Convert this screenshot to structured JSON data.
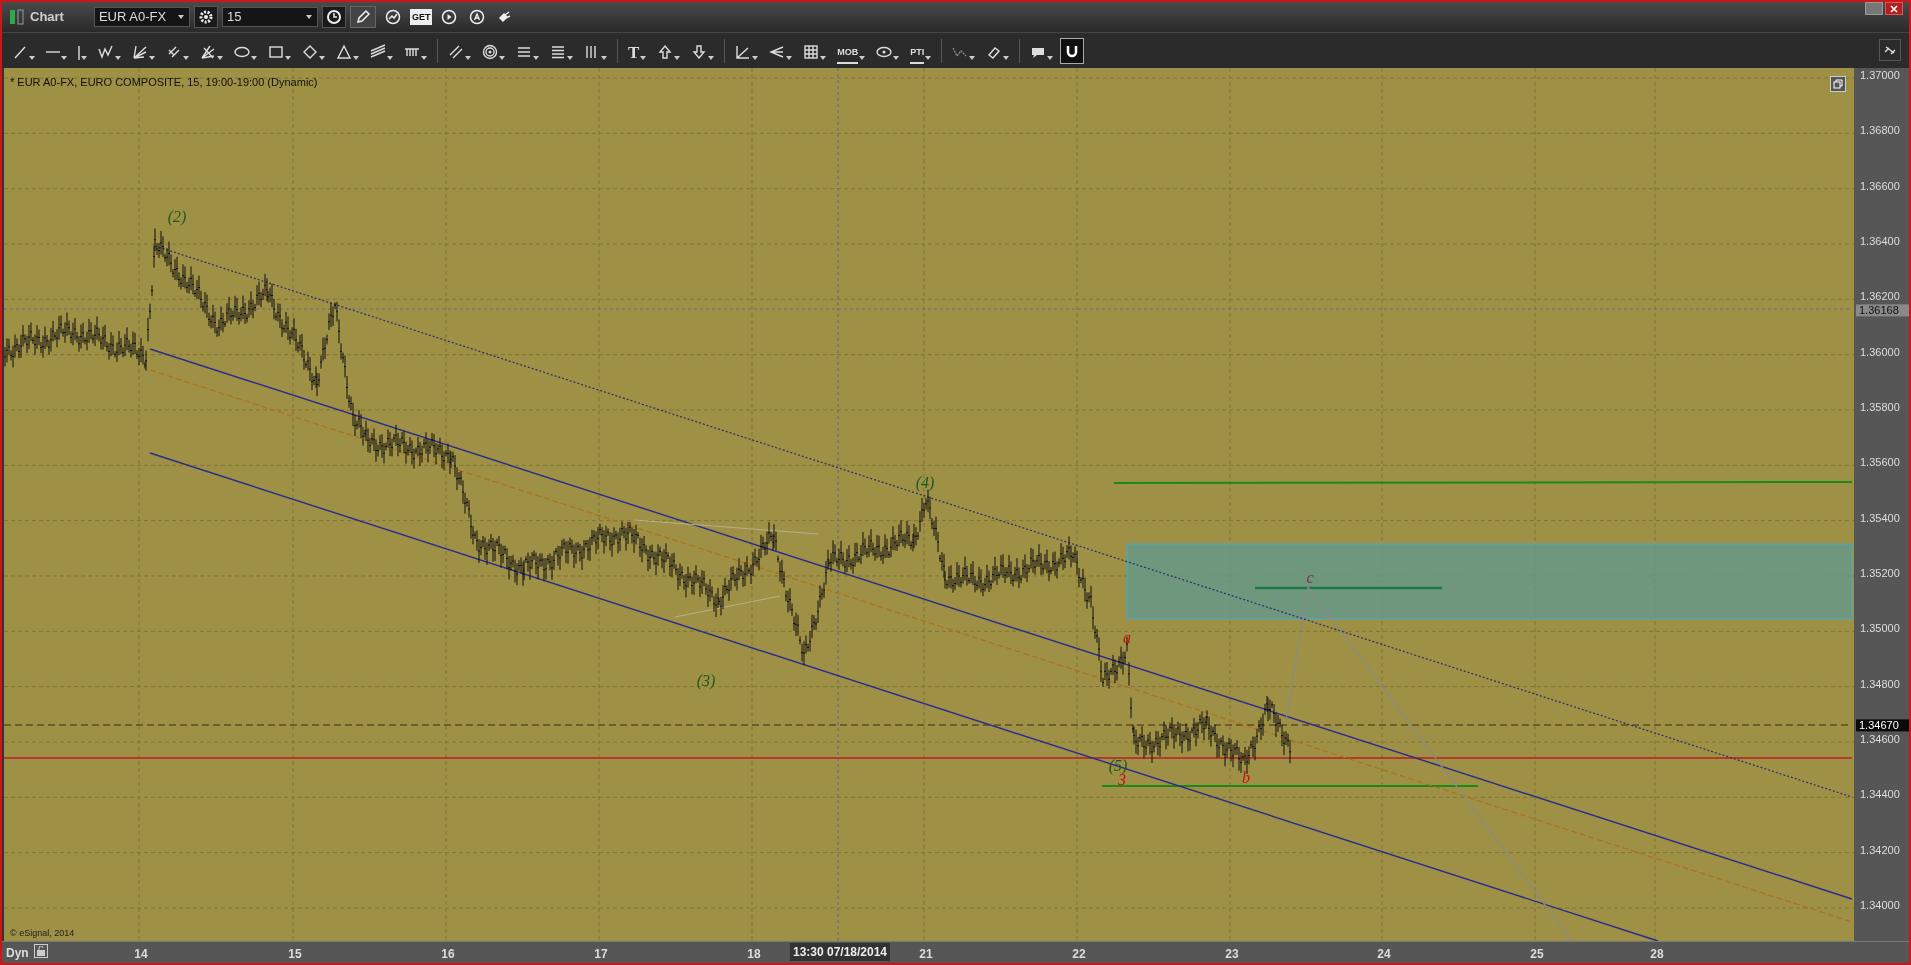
{
  "window": {
    "title": "Chart"
  },
  "toolbar": {
    "symbol": "EUR A0-FX",
    "interval": "15",
    "labels": [
      "GET",
      "T",
      "MOB",
      "PTI"
    ]
  },
  "chart": {
    "legend": "* EUR A0-FX, EURO COMPOSITE, 15, 19:00-19:00 (Dynamic)",
    "copyright": "© eSignal, 2014",
    "wave_labels": [
      {
        "text": "(2)",
        "color": "#1e5a1e"
      },
      {
        "text": "(4)",
        "color": "#1e5a1e"
      },
      {
        "text": "c",
        "color": "#8a2a4a"
      },
      {
        "text": "a",
        "color": "#cc1010"
      },
      {
        "text": "(3)",
        "color": "#1e5a1e"
      },
      {
        "text": "(5)",
        "color": "#1e5a1e"
      },
      {
        "text": "3",
        "color": "#cc1010"
      },
      {
        "text": "b",
        "color": "#cc1010"
      }
    ]
  },
  "price_axis": {
    "labels": [
      "1.37000",
      "1.36800",
      "1.36600",
      "1.36400",
      "1.36200",
      "1.36000",
      "1.35800",
      "1.35600",
      "1.35400",
      "1.35200",
      "1.35000",
      "1.34800",
      "1.34600",
      "1.34400",
      "1.34200",
      "1.34000"
    ],
    "tags": [
      {
        "text": "1.36168",
        "kind": "marker"
      },
      {
        "text": "1.34670",
        "kind": "last"
      }
    ]
  },
  "time_axis": {
    "mode": "Dyn",
    "labels": [
      "14",
      "15",
      "16",
      "17",
      "18",
      "21",
      "22",
      "23",
      "24",
      "25",
      "28"
    ],
    "crosshair": "13:30 07/18/2014"
  }
}
